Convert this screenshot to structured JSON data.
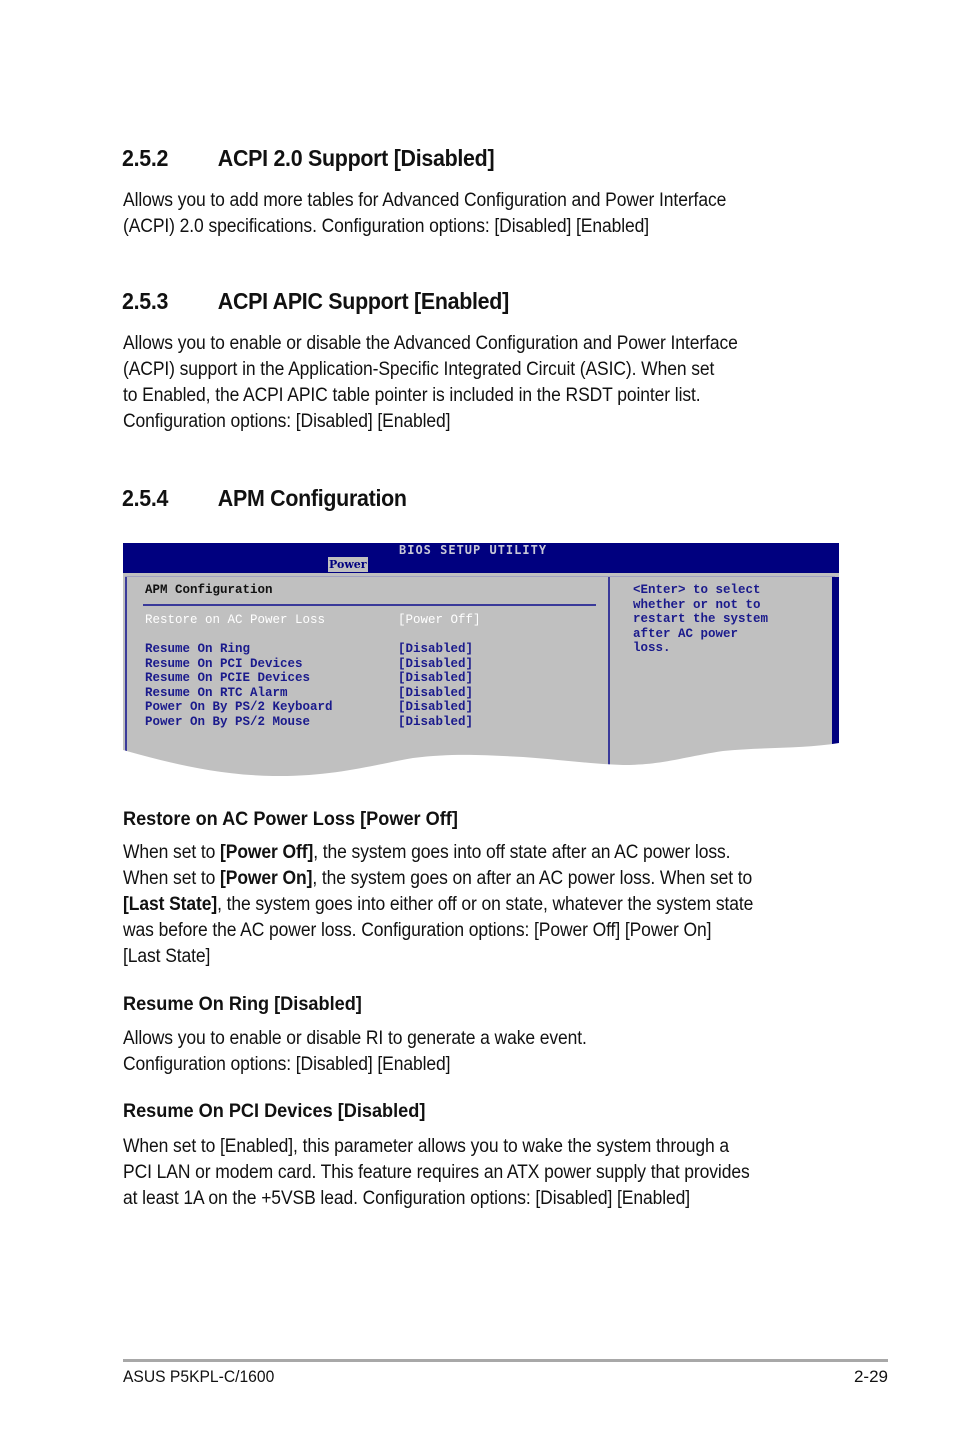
{
  "sections": [
    {
      "number": "2.5.2",
      "title": "ACPI 2.0 Support [Disabled]",
      "lines": [
        "Allows you to add more tables for Advanced Configuration and Power Interface",
        "(ACPI) 2.0 specifications. Configuration options: [Disabled] [Enabled]"
      ]
    },
    {
      "number": "2.5.3",
      "title": "ACPI APIC Support [Enabled]",
      "lines": [
        "Allows you to enable or disable the Advanced Configuration and Power Interface",
        "(ACPI) support in the Application-Specific Integrated Circuit (ASIC). When set",
        "to Enabled, the ACPI APIC table pointer is included in the RSDT pointer list.",
        "Configuration options: [Disabled] [Enabled]"
      ]
    },
    {
      "number": "2.5.4",
      "title": "APM Configuration"
    }
  ],
  "bios": {
    "title": "BIOS SETUP UTILITY",
    "active_tab": "Power",
    "section_title": "APM Configuration",
    "selected_item": {
      "label": "Restore on AC Power Loss",
      "value": "[Power Off]"
    },
    "items": [
      {
        "label": "Resume On Ring",
        "value": "[Disabled]"
      },
      {
        "label": "Resume On PCI Devices",
        "value": "[Disabled]"
      },
      {
        "label": "Resume On PCIE Devices",
        "value": "[Disabled]"
      },
      {
        "label": "Resume On RTC Alarm",
        "value": "[Disabled]"
      },
      {
        "label": "Power On By PS/2 Keyboard",
        "value": "[Disabled]"
      },
      {
        "label": "Power On By PS/2 Mouse",
        "value": "[Disabled]"
      }
    ],
    "help_lines": [
      "<Enter> to select",
      "whether or not to",
      "restart the system",
      "after AC power",
      "loss."
    ],
    "colors": {
      "title_bar": "#00007f",
      "panel": "#c0c0c0",
      "text": "#1a1a8c",
      "selected_text": "#ffffff"
    }
  },
  "subsections": [
    {
      "title": "Restore on AC Power Loss [Power Off]",
      "lines": [
        [
          {
            "t": "When set to "
          },
          {
            "t": "[Power Off]",
            "b": true
          },
          {
            "t": ", the system goes into off state after an AC power loss."
          }
        ],
        [
          {
            "t": "When set to "
          },
          {
            "t": "[Power On]",
            "b": true
          },
          {
            "t": ", the system goes on after an AC power loss. When set to"
          }
        ],
        [
          {
            "t": "[Last State]",
            "b": true
          },
          {
            "t": ", the system goes into either off or on state, whatever the system state"
          }
        ],
        [
          {
            "t": "was before the AC power loss. Configuration options: [Power Off] [Power On]"
          }
        ],
        [
          {
            "t": "[Last State]"
          }
        ]
      ]
    },
    {
      "title": "Resume On Ring [Disabled]",
      "lines": [
        [
          {
            "t": "Allows you to enable or disable RI to generate a wake event."
          }
        ],
        [
          {
            "t": "Configuration options: [Disabled] [Enabled]"
          }
        ]
      ]
    },
    {
      "title": "Resume On PCI Devices [Disabled]",
      "lines": [
        [
          {
            "t": "When set to [Enabled], this parameter allows you to wake the system through a"
          }
        ],
        [
          {
            "t": "PCI LAN or modem card. This feature requires an ATX power supply that provides"
          }
        ],
        [
          {
            "t": "at least 1A on the +5VSB lead. Configuration options: [Disabled] [Enabled]"
          }
        ]
      ]
    }
  ],
  "footer": {
    "left": "ASUS P5KPL-C/1600",
    "right": "2-29"
  }
}
